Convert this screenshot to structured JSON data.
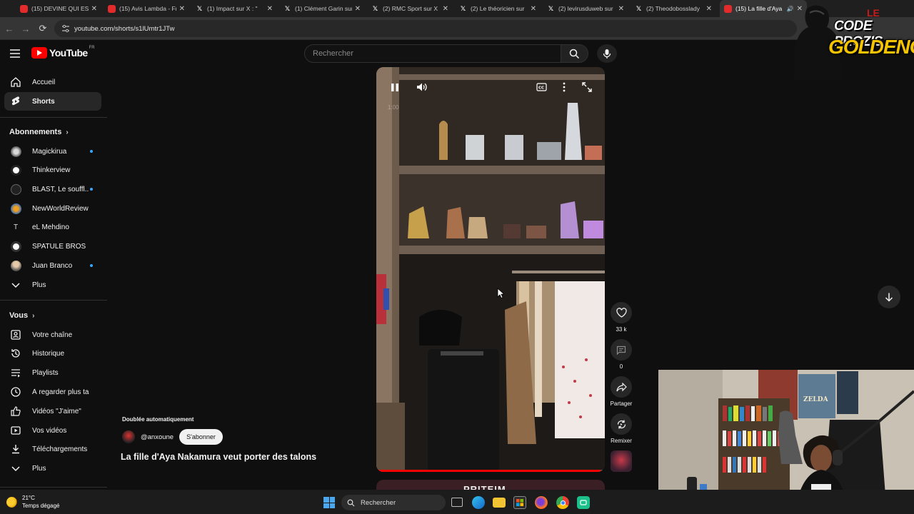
{
  "browser": {
    "tabs": [
      {
        "title": "(15) DEVINE QUI EST",
        "favicon": "youtube-icon"
      },
      {
        "title": "(15) Avis Lambda - Fr",
        "favicon": "youtube-icon"
      },
      {
        "title": "(1) Impact sur X : \"",
        "favicon": "x-icon"
      },
      {
        "title": "(1) Clément Garin sur",
        "favicon": "x-icon"
      },
      {
        "title": "(2) RMC Sport sur X :",
        "favicon": "x-icon"
      },
      {
        "title": "(2) Le théoricien sur",
        "favicon": "x-icon"
      },
      {
        "title": "(2) levirusduweb sur",
        "favicon": "x-icon"
      },
      {
        "title": "(2) Theodobosslady",
        "favicon": "x-icon"
      },
      {
        "title": "(15) La fille d'Aya",
        "favicon": "youtube-icon",
        "active": true
      }
    ],
    "url": "youtube.com/shorts/s1lUmtr1JTw"
  },
  "overlay_logo": {
    "top": "LE",
    "line1": "CODE PROZIS",
    "line2": "GOLDENG"
  },
  "youtube": {
    "logo_text": "YouTube",
    "region": "FR",
    "search_placeholder": "Rechercher"
  },
  "sidebar": {
    "main": [
      {
        "label": "Accueil",
        "icon": "home-icon"
      },
      {
        "label": "Shorts",
        "icon": "shorts-icon",
        "active": true
      }
    ],
    "subscriptions_title": "Abonnements",
    "subscriptions": [
      {
        "label": "Magickirua",
        "dot": true
      },
      {
        "label": "Thinkerview",
        "dot": false
      },
      {
        "label": "BLAST, Le souffl...",
        "dot": true
      },
      {
        "label": "NewWorldReview",
        "dot": false
      },
      {
        "label": "eL Mehdino",
        "dot": false
      },
      {
        "label": "SPATULE BROS",
        "dot": false
      },
      {
        "label": "Juan Branco",
        "dot": true
      }
    ],
    "subscriptions_more": "Plus",
    "you_title": "Vous",
    "you": [
      {
        "label": "Votre chaîne",
        "icon": "channel-icon"
      },
      {
        "label": "Historique",
        "icon": "history-icon"
      },
      {
        "label": "Playlists",
        "icon": "playlists-icon"
      },
      {
        "label": "À regarder plus tard",
        "icon": "watch-later-icon"
      },
      {
        "label": "Vidéos \"J'aime\"",
        "icon": "liked-icon"
      },
      {
        "label": "Vos vidéos",
        "icon": "your-videos-icon"
      },
      {
        "label": "Téléchargements",
        "icon": "downloads-icon"
      },
      {
        "label": "Plus",
        "icon": "chevron-down-icon"
      }
    ]
  },
  "short": {
    "dubbed_label": "Doublée automatiquement",
    "channel_handle": "@anxoune",
    "subscribe_label": "S'abonner",
    "title": "La fille d'Aya Nakamura veut porter des talons",
    "timecode": "1:00",
    "progress": 0.98,
    "next_short_text": "PRITEIM"
  },
  "actions": {
    "like_count": "33 k",
    "comment_count": "0",
    "share_label": "Partager",
    "remix_label": "Remixer"
  },
  "taskbar": {
    "temperature": "21°C",
    "weather": "Temps dégagé",
    "search_label": "Rechercher"
  }
}
